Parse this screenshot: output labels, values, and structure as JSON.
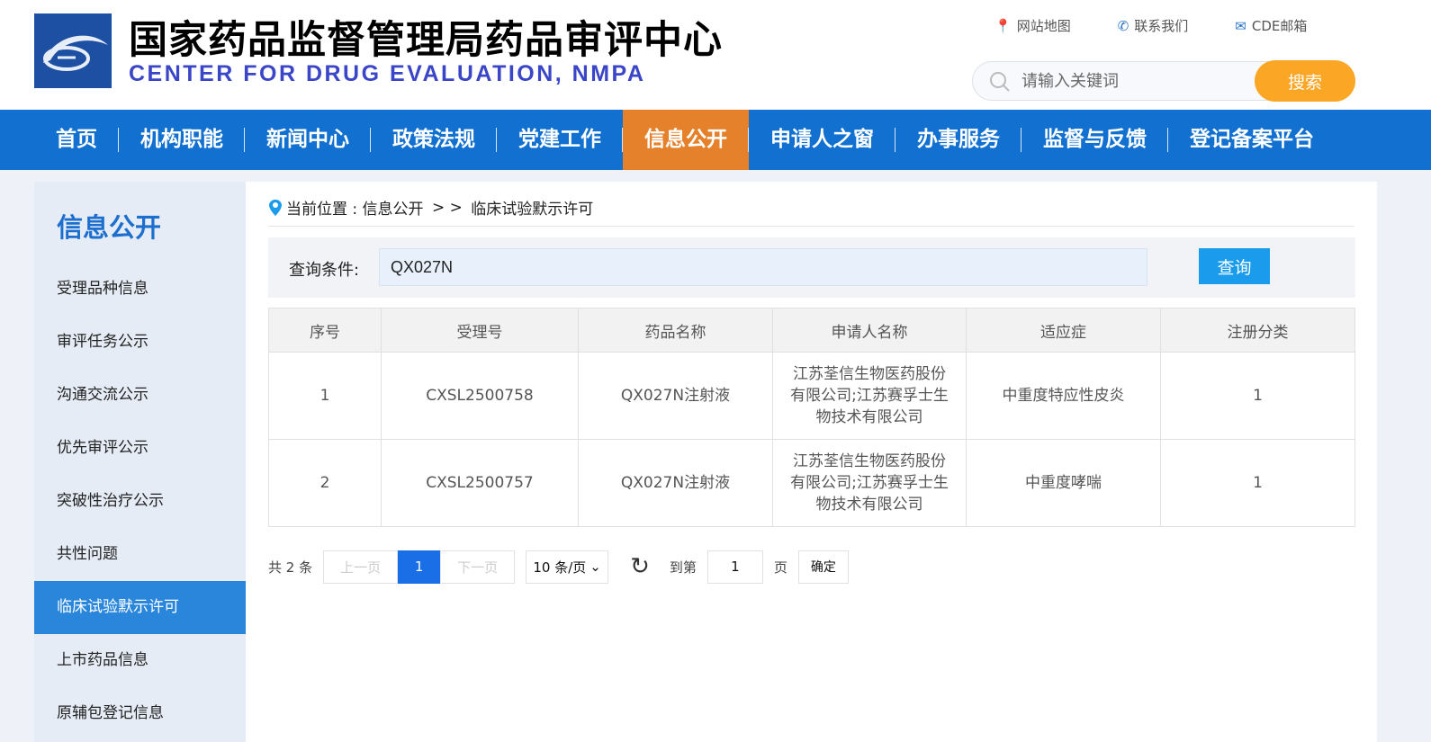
{
  "header": {
    "title_cn": "国家药品监督管理局药品审评中心",
    "title_en": "CENTER FOR DRUG EVALUATION, NMPA",
    "links": [
      "网站地图",
      "联系我们",
      "CDE邮箱"
    ],
    "search_placeholder": "请输入关键词",
    "search_button": "搜索"
  },
  "nav": [
    "首页",
    "机构职能",
    "新闻中心",
    "政策法规",
    "党建工作",
    "信息公开",
    "申请人之窗",
    "办事服务",
    "监督与反馈",
    "登记备案平台"
  ],
  "sidebar": {
    "title": "信息公开",
    "items": [
      "受理品种信息",
      "审评任务公示",
      "沟通交流公示",
      "优先审评公示",
      "突破性治疗公示",
      "共性问题",
      "临床试验默示许可",
      "上市药品信息",
      "原辅包登记信息"
    ]
  },
  "breadcrumb": {
    "prefix": "当前位置 : 信息公开",
    "sep": " > > ",
    "current": "临床试验默示许可"
  },
  "query": {
    "label": "查询条件:",
    "value": "QX027N",
    "button": "查询"
  },
  "table": {
    "headers": [
      "序号",
      "受理号",
      "药品名称",
      "申请人名称",
      "适应症",
      "注册分类"
    ],
    "rows": [
      [
        "1",
        "CXSL2500758",
        "QX027N注射液",
        "江苏荃信生物医药股份有限公司;江苏赛孚士生物技术有限公司",
        "中重度特应性皮炎",
        "1"
      ],
      [
        "2",
        "CXSL2500757",
        "QX027N注射液",
        "江苏荃信生物医药股份有限公司;江苏赛孚士生物技术有限公司",
        "中重度哮喘",
        "1"
      ]
    ]
  },
  "pager": {
    "total": "共 2 条",
    "prev": "上一页",
    "current": "1",
    "next": "下一页",
    "page_size": "10 条/页",
    "goto": "到第",
    "goto_value": "1",
    "page_unit": "页",
    "confirm": "确定"
  }
}
